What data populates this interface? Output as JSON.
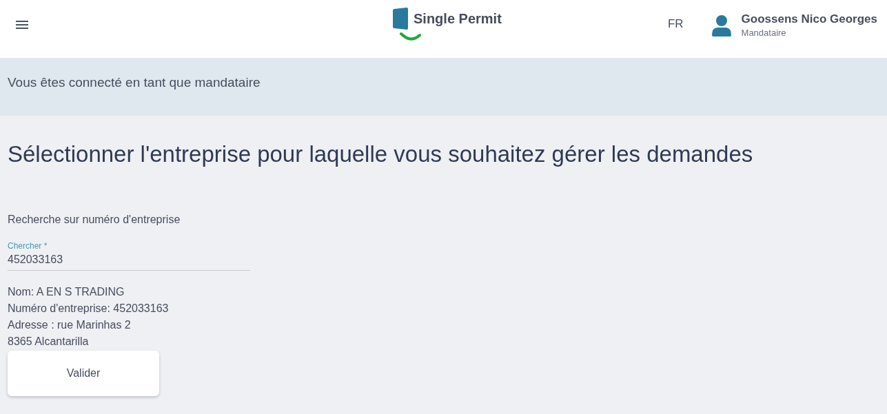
{
  "header": {
    "logo_text": "Single Permit",
    "language": "FR",
    "user": {
      "name": "Goossens Nico Georges",
      "role": "Mandataire"
    }
  },
  "banner": "Vous êtes connecté en tant que mandataire",
  "page_title": "Sélectionner l'entreprise pour laquelle vous souhaitez gérer les demandes",
  "search": {
    "section_label": "Recherche sur numéro d'entreprise",
    "field": {
      "label": "Chercher *",
      "value": "452033163"
    }
  },
  "company": [
    "Nom: A EN S TRADING",
    "Numéro d'entreprise: 452033163",
    "Adresse : rue Marinhas 2",
    "8365 Alcantarilla"
  ],
  "buttons": [
    "Valider"
  ]
}
